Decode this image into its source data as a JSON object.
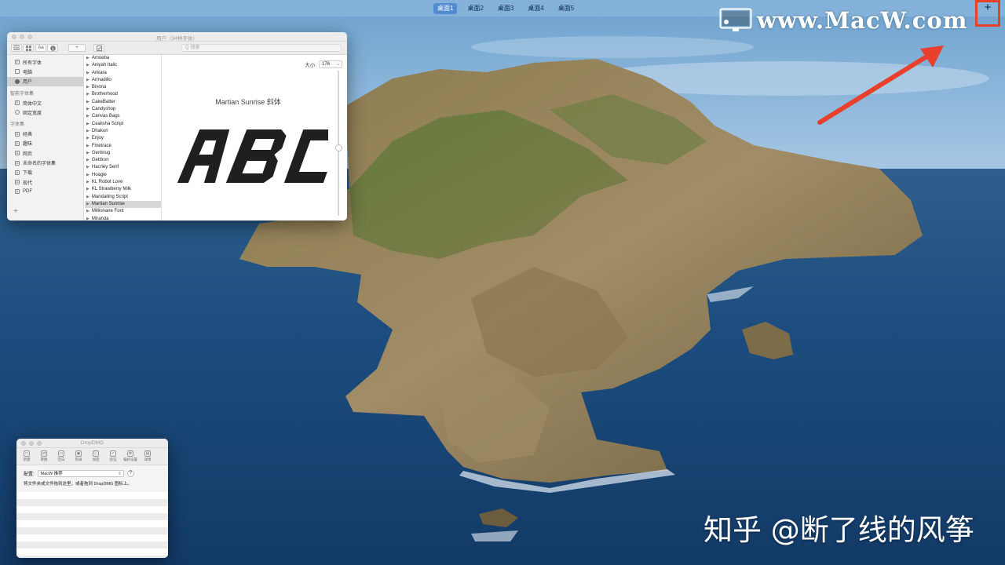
{
  "spaces": [
    "桌面1",
    "桌面2",
    "桌面3",
    "桌面4",
    "桌面5"
  ],
  "add_space_label": "+",
  "watermark": {
    "text": "www.MacW.com",
    "icon": "mac-monitor-icon"
  },
  "zhihu_credit": "知乎 @断了线的风筝",
  "font_book": {
    "title": "用户（34种字体）",
    "toolbar": {
      "add": "+",
      "search_placeholder": "Q 搜索"
    },
    "sidebar": {
      "top_items": [
        "所有字体",
        "电脑",
        "用户"
      ],
      "smart_header": "智能字体集",
      "smart_items": [
        "简体中文",
        "固定宽度"
      ],
      "collections_header": "字体集",
      "collection_items": [
        "经典",
        "趣味",
        "网页",
        "未命名的字体集",
        "下载",
        "现代",
        "PDF"
      ],
      "add_label": "+"
    },
    "fonts": [
      "Amoeba",
      "Aniyah Italic",
      "Ankara",
      "Armadillo",
      "Bivona",
      "Brotherhood",
      "CakeBatter",
      "Candyshop",
      "Canvas Bags",
      "Cealisha Script",
      "Dhakuri",
      "Enjoy",
      "Finetrace",
      "Genbrug",
      "GettIron",
      "Hacrley Serif",
      "Hoagie",
      "KL Robot Love",
      "KL Strawberry Milk",
      "Mandailing Script",
      "Martian Sunrise",
      "Millionaire Font",
      "Miranda"
    ],
    "selected_font": "Martian Sunrise",
    "size_label": "大小:",
    "size_value": "176",
    "preview_name": "Martian Sunrise 斜体",
    "preview_text": "ABC"
  },
  "dropdmg": {
    "title": "DropDMG",
    "tools": [
      "新建",
      "转换",
      "空白",
      "刻录",
      "加密",
      "验证",
      "偏好设置",
      "详情"
    ],
    "config_label": "配置:",
    "config_value": "MacW 推荐",
    "help": "?",
    "hint": "将文件夹或文件拖到这里，或者拖到 DropDMG 图标上。"
  },
  "colors": {
    "highlight_red": "#e8402c",
    "space_active": "#3a7fcc"
  }
}
